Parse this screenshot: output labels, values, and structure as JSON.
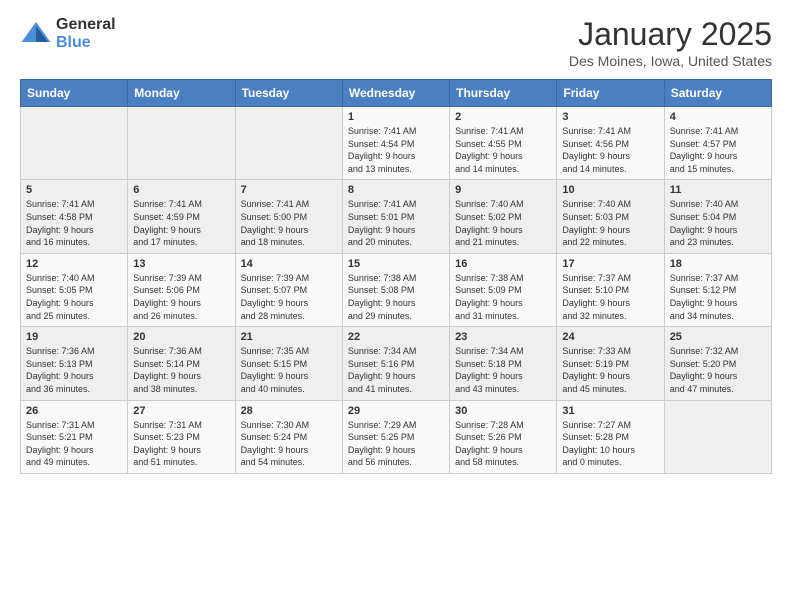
{
  "header": {
    "logo_general": "General",
    "logo_blue": "Blue",
    "month_title": "January 2025",
    "location": "Des Moines, Iowa, United States"
  },
  "weekdays": [
    "Sunday",
    "Monday",
    "Tuesday",
    "Wednesday",
    "Thursday",
    "Friday",
    "Saturday"
  ],
  "weeks": [
    [
      {
        "day": "",
        "info": ""
      },
      {
        "day": "",
        "info": ""
      },
      {
        "day": "",
        "info": ""
      },
      {
        "day": "1",
        "info": "Sunrise: 7:41 AM\nSunset: 4:54 PM\nDaylight: 9 hours\nand 13 minutes."
      },
      {
        "day": "2",
        "info": "Sunrise: 7:41 AM\nSunset: 4:55 PM\nDaylight: 9 hours\nand 14 minutes."
      },
      {
        "day": "3",
        "info": "Sunrise: 7:41 AM\nSunset: 4:56 PM\nDaylight: 9 hours\nand 14 minutes."
      },
      {
        "day": "4",
        "info": "Sunrise: 7:41 AM\nSunset: 4:57 PM\nDaylight: 9 hours\nand 15 minutes."
      }
    ],
    [
      {
        "day": "5",
        "info": "Sunrise: 7:41 AM\nSunset: 4:58 PM\nDaylight: 9 hours\nand 16 minutes."
      },
      {
        "day": "6",
        "info": "Sunrise: 7:41 AM\nSunset: 4:59 PM\nDaylight: 9 hours\nand 17 minutes."
      },
      {
        "day": "7",
        "info": "Sunrise: 7:41 AM\nSunset: 5:00 PM\nDaylight: 9 hours\nand 18 minutes."
      },
      {
        "day": "8",
        "info": "Sunrise: 7:41 AM\nSunset: 5:01 PM\nDaylight: 9 hours\nand 20 minutes."
      },
      {
        "day": "9",
        "info": "Sunrise: 7:40 AM\nSunset: 5:02 PM\nDaylight: 9 hours\nand 21 minutes."
      },
      {
        "day": "10",
        "info": "Sunrise: 7:40 AM\nSunset: 5:03 PM\nDaylight: 9 hours\nand 22 minutes."
      },
      {
        "day": "11",
        "info": "Sunrise: 7:40 AM\nSunset: 5:04 PM\nDaylight: 9 hours\nand 23 minutes."
      }
    ],
    [
      {
        "day": "12",
        "info": "Sunrise: 7:40 AM\nSunset: 5:05 PM\nDaylight: 9 hours\nand 25 minutes."
      },
      {
        "day": "13",
        "info": "Sunrise: 7:39 AM\nSunset: 5:06 PM\nDaylight: 9 hours\nand 26 minutes."
      },
      {
        "day": "14",
        "info": "Sunrise: 7:39 AM\nSunset: 5:07 PM\nDaylight: 9 hours\nand 28 minutes."
      },
      {
        "day": "15",
        "info": "Sunrise: 7:38 AM\nSunset: 5:08 PM\nDaylight: 9 hours\nand 29 minutes."
      },
      {
        "day": "16",
        "info": "Sunrise: 7:38 AM\nSunset: 5:09 PM\nDaylight: 9 hours\nand 31 minutes."
      },
      {
        "day": "17",
        "info": "Sunrise: 7:37 AM\nSunset: 5:10 PM\nDaylight: 9 hours\nand 32 minutes."
      },
      {
        "day": "18",
        "info": "Sunrise: 7:37 AM\nSunset: 5:12 PM\nDaylight: 9 hours\nand 34 minutes."
      }
    ],
    [
      {
        "day": "19",
        "info": "Sunrise: 7:36 AM\nSunset: 5:13 PM\nDaylight: 9 hours\nand 36 minutes."
      },
      {
        "day": "20",
        "info": "Sunrise: 7:36 AM\nSunset: 5:14 PM\nDaylight: 9 hours\nand 38 minutes."
      },
      {
        "day": "21",
        "info": "Sunrise: 7:35 AM\nSunset: 5:15 PM\nDaylight: 9 hours\nand 40 minutes."
      },
      {
        "day": "22",
        "info": "Sunrise: 7:34 AM\nSunset: 5:16 PM\nDaylight: 9 hours\nand 41 minutes."
      },
      {
        "day": "23",
        "info": "Sunrise: 7:34 AM\nSunset: 5:18 PM\nDaylight: 9 hours\nand 43 minutes."
      },
      {
        "day": "24",
        "info": "Sunrise: 7:33 AM\nSunset: 5:19 PM\nDaylight: 9 hours\nand 45 minutes."
      },
      {
        "day": "25",
        "info": "Sunrise: 7:32 AM\nSunset: 5:20 PM\nDaylight: 9 hours\nand 47 minutes."
      }
    ],
    [
      {
        "day": "26",
        "info": "Sunrise: 7:31 AM\nSunset: 5:21 PM\nDaylight: 9 hours\nand 49 minutes."
      },
      {
        "day": "27",
        "info": "Sunrise: 7:31 AM\nSunset: 5:23 PM\nDaylight: 9 hours\nand 51 minutes."
      },
      {
        "day": "28",
        "info": "Sunrise: 7:30 AM\nSunset: 5:24 PM\nDaylight: 9 hours\nand 54 minutes."
      },
      {
        "day": "29",
        "info": "Sunrise: 7:29 AM\nSunset: 5:25 PM\nDaylight: 9 hours\nand 56 minutes."
      },
      {
        "day": "30",
        "info": "Sunrise: 7:28 AM\nSunset: 5:26 PM\nDaylight: 9 hours\nand 58 minutes."
      },
      {
        "day": "31",
        "info": "Sunrise: 7:27 AM\nSunset: 5:28 PM\nDaylight: 10 hours\nand 0 minutes."
      },
      {
        "day": "",
        "info": ""
      }
    ]
  ]
}
